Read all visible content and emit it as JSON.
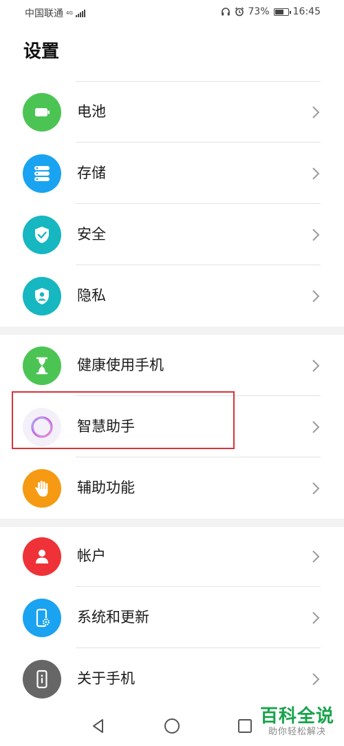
{
  "status_bar": {
    "carrier": "中国联通",
    "network": "4G",
    "battery": "73%",
    "battery_level": 0.73,
    "time": "16:45"
  },
  "page_title": "设置",
  "groups": [
    {
      "items": [
        {
          "label": "电池",
          "icon": "battery-icon",
          "color": "#4cc454"
        },
        {
          "label": "存储",
          "icon": "storage-icon",
          "color": "#1aa3f0"
        },
        {
          "label": "安全",
          "icon": "shield-check-icon",
          "color": "#16b7c0"
        },
        {
          "label": "隐私",
          "icon": "privacy-shield-icon",
          "color": "#16b7c0"
        }
      ]
    },
    {
      "items": [
        {
          "label": "健康使用手机",
          "icon": "hourglass-icon",
          "color": "#4cc454"
        },
        {
          "label": "智慧助手",
          "icon": "assistant-ring-icon",
          "color": "#f4f0fa"
        },
        {
          "label": "辅助功能",
          "icon": "hand-icon",
          "color": "#f59a12"
        }
      ]
    },
    {
      "items": [
        {
          "label": "帐户",
          "icon": "account-icon",
          "color": "#ee3238"
        },
        {
          "label": "系统和更新",
          "icon": "phone-gear-icon",
          "color": "#1aa3f0"
        },
        {
          "label": "关于手机",
          "icon": "phone-info-icon",
          "color": "#666666"
        }
      ]
    }
  ],
  "watermark": {
    "title": "百科全说",
    "subtitle": "助你轻松解决"
  },
  "colors": {
    "highlight": "#d9313a",
    "watermark": "#17a34a"
  }
}
